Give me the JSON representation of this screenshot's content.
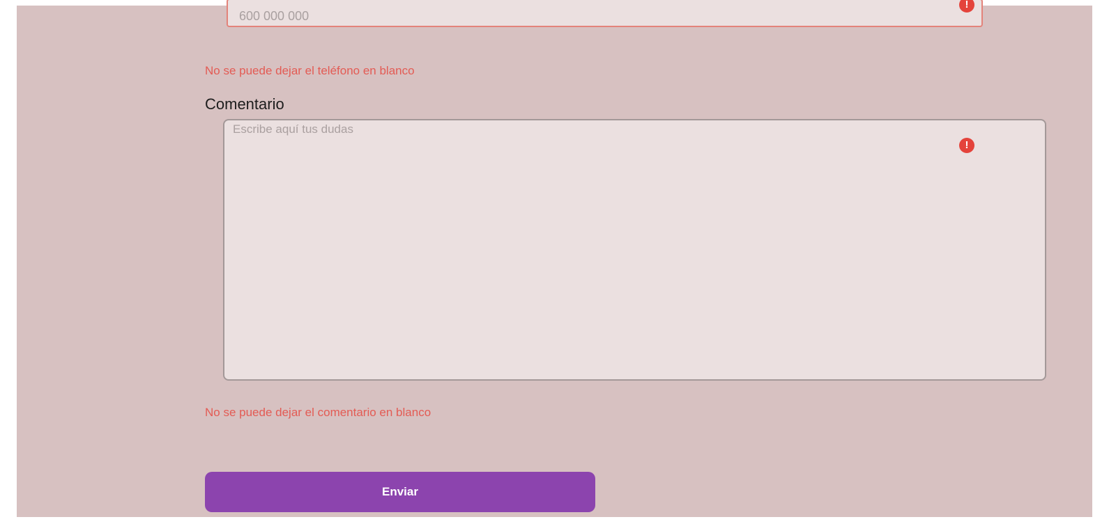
{
  "form": {
    "phone": {
      "placeholder": "600 000 000",
      "value": "",
      "error_icon": "exclamation-circle-icon",
      "error_message": "No se puede dejar el teléfono en blanco"
    },
    "comment": {
      "label": "Comentario",
      "placeholder": "Escribe aquí tus dudas",
      "value": "",
      "error_icon": "exclamation-circle-icon",
      "error_message": "No se puede dejar el comentario en blanco"
    },
    "submit_label": "Enviar"
  },
  "icons": {
    "error_glyph": "!"
  },
  "colors": {
    "page_background": "#d7c1c1",
    "input_background": "#ebe0e0",
    "error": "#e35b54",
    "error_border": "#e3837a",
    "button": "#8c44ae"
  }
}
